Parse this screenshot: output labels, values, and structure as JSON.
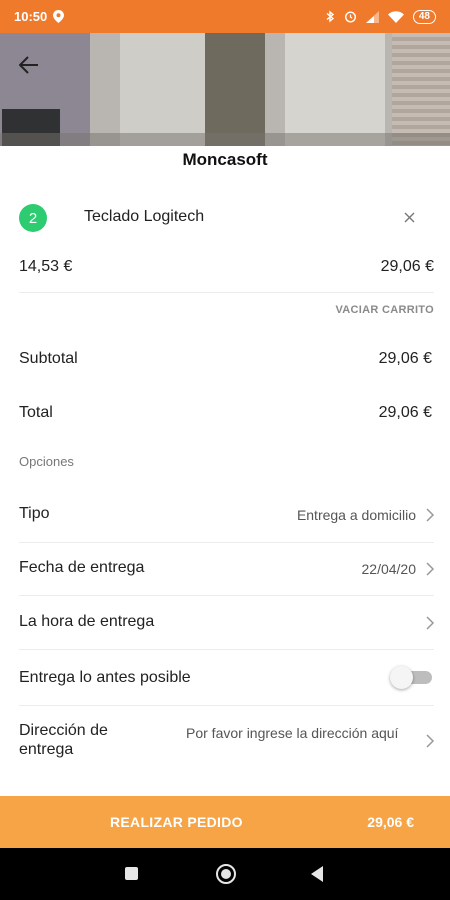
{
  "status_bar": {
    "time": "10:50",
    "battery": "48",
    "icons": [
      "location-icon",
      "bluetooth-icon",
      "alarm-icon",
      "signal-icon",
      "wifi-icon",
      "battery-icon"
    ]
  },
  "header": {
    "shop_name": "Moncasoft",
    "back_icon": "arrow-left-icon"
  },
  "cart_item": {
    "quantity": "2",
    "name": "Teclado Logitech",
    "remove_icon": "close-icon",
    "unit_price": "14,53 €",
    "line_total": "29,06 €"
  },
  "empty_cart_label": "VACIAR CARRITO",
  "summary": {
    "subtotal_label": "Subtotal",
    "subtotal_value": "29,06 €",
    "total_label": "Total",
    "total_value": "29,06 €"
  },
  "options": {
    "section_label": "Opciones",
    "type_label": "Tipo",
    "type_value": "Entrega a domicilio",
    "date_label": "Fecha de entrega",
    "date_value": "22/04/20",
    "time_label": "La hora de entrega",
    "asap_label": "Entrega lo antes posible",
    "asap_enabled": false,
    "address_label": "Dirección de entrega",
    "address_placeholder": "Por favor ingrese la dirección aquí"
  },
  "order_bar": {
    "button_label": "REALIZAR PEDIDO",
    "total": "29,06 €"
  },
  "colors": {
    "status_bar": "#f07a2c",
    "order_bar": "#f6a445",
    "badge": "#2ecc71"
  }
}
